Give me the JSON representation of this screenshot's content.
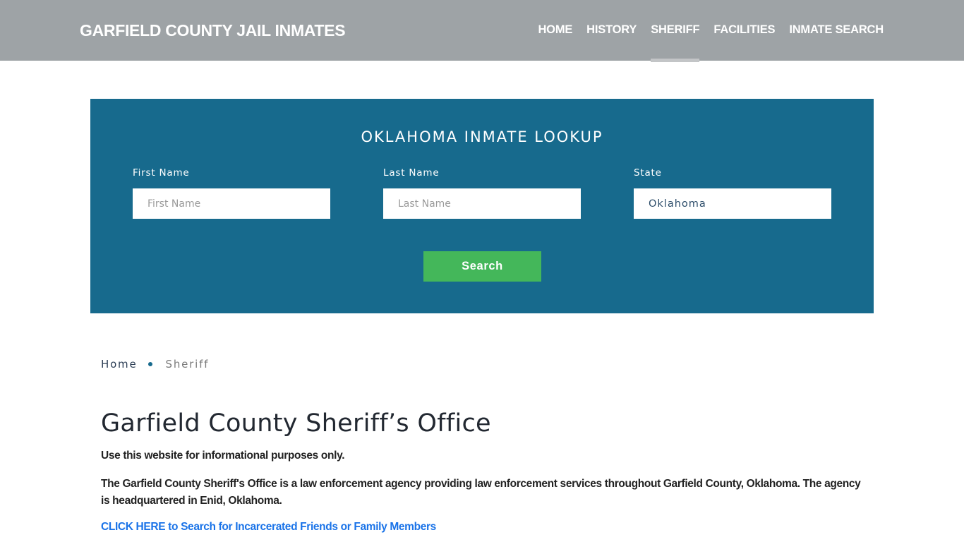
{
  "header": {
    "brand": "GARFIELD COUNTY JAIL INMATES",
    "nav": [
      {
        "label": "HOME",
        "active": false
      },
      {
        "label": "HISTORY",
        "active": false
      },
      {
        "label": "SHERIFF",
        "active": true
      },
      {
        "label": "FACILITIES",
        "active": false
      },
      {
        "label": "INMATE SEARCH",
        "active": false
      }
    ]
  },
  "lookup": {
    "title": "OKLAHOMA INMATE LOOKUP",
    "first_name": {
      "label": "First Name",
      "placeholder": "First Name",
      "value": ""
    },
    "last_name": {
      "label": "Last Name",
      "placeholder": "Last Name",
      "value": ""
    },
    "state": {
      "label": "State",
      "value": "Oklahoma"
    },
    "search_label": "Search",
    "colors": {
      "panel": "#176a8d",
      "button": "#44b75a"
    }
  },
  "breadcrumb": {
    "home": "Home",
    "current": "Sheriff"
  },
  "content": {
    "title": "Garfield County Sheriff’s Office",
    "disclaimer": "Use this website for informational purposes only.",
    "description": "The Garfield County Sheriff's Office is a law enforcement agency providing law enforcement services throughout Garfield County, Oklahoma. The agency is headquartered in Enid, Oklahoma.",
    "cta_link": "CLICK HERE to Search for Incarcerated Friends or Family Members",
    "link_color": "#1a73e8"
  }
}
